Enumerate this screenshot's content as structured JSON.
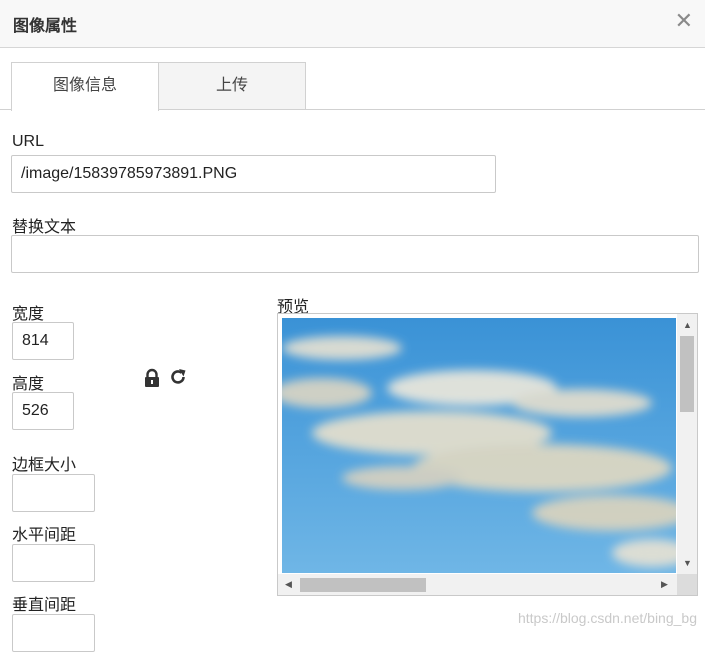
{
  "dialog": {
    "title": "图像属性",
    "close_symbol": "✕"
  },
  "tabs": [
    {
      "label": "图像信息",
      "active": true
    },
    {
      "label": "上传",
      "active": false
    }
  ],
  "form": {
    "url_label": "URL",
    "url_value": "/image/15839785973891.PNG",
    "alt_label": "替换文本",
    "alt_value": "",
    "width_label": "宽度",
    "width_value": "814",
    "height_label": "高度",
    "height_value": "526",
    "border_label": "边框大小",
    "border_value": "",
    "hspace_label": "水平间距",
    "hspace_value": "",
    "vspace_label": "垂直间距",
    "vspace_value": ""
  },
  "icons": {
    "lock": "lock-icon",
    "reset": "reset-size-icon"
  },
  "preview": {
    "label": "预览",
    "sky_color": "#4a9fdc"
  },
  "watermark": "https://blog.csdn.net/bing_bg"
}
